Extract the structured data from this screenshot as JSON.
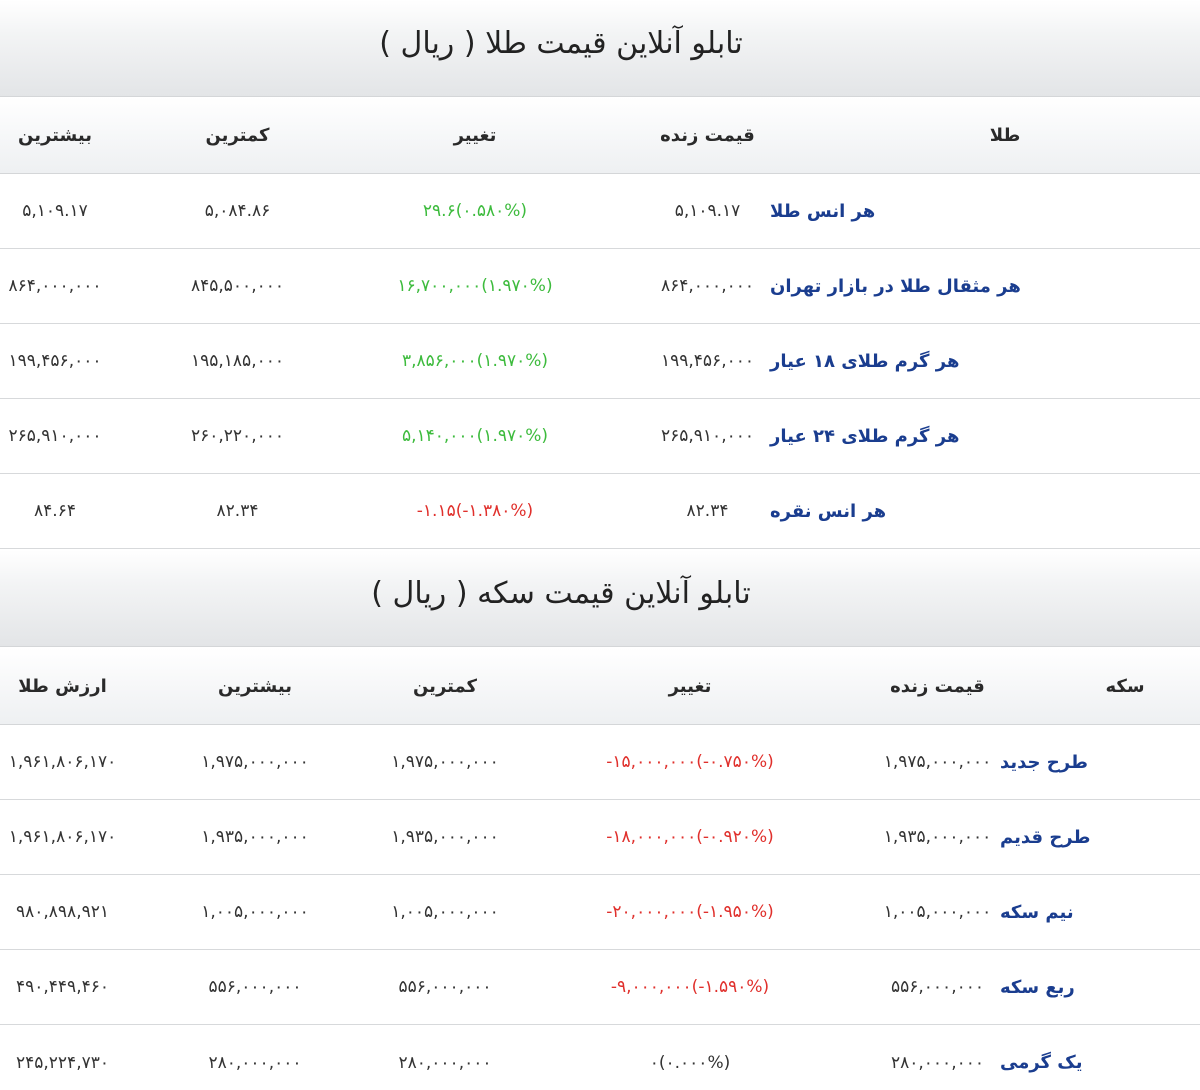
{
  "gold_board": {
    "title": "تابلو آنلاین قیمت طلا ( ریال )",
    "headers": {
      "name": "طلا",
      "live_price": "قیمت زنده",
      "change": "تغییر",
      "lowest": "کمترین",
      "highest": "بیشترین"
    },
    "rows": [
      {
        "name": "هر انس طلا",
        "live_price": "۵,۱۰۹.۱۷",
        "change": "۲۹.۶(۰.۵۸۰%)",
        "direction": "up",
        "lowest": "۵,۰۸۴.۸۶",
        "highest": "۵,۱۰۹.۱۷"
      },
      {
        "name": "هر مثقال طلا در بازار تهران",
        "live_price": "۸۶۴,۰۰۰,۰۰۰",
        "change": "۱۶,۷۰۰,۰۰۰(۱.۹۷۰%)",
        "direction": "up",
        "lowest": "۸۴۵,۵۰۰,۰۰۰",
        "highest": "۸۶۴,۰۰۰,۰۰۰"
      },
      {
        "name": "هر گرم طلای ۱۸ عیار",
        "live_price": "۱۹۹,۴۵۶,۰۰۰",
        "change": "۳,۸۵۶,۰۰۰(۱.۹۷۰%)",
        "direction": "up",
        "lowest": "۱۹۵,۱۸۵,۰۰۰",
        "highest": "۱۹۹,۴۵۶,۰۰۰"
      },
      {
        "name": "هر گرم طلای ۲۴ عیار",
        "live_price": "۲۶۵,۹۱۰,۰۰۰",
        "change": "۵,۱۴۰,۰۰۰(۱.۹۷۰%)",
        "direction": "up",
        "lowest": "۲۶۰,۲۲۰,۰۰۰",
        "highest": "۲۶۵,۹۱۰,۰۰۰"
      },
      {
        "name": "هر انس نقره",
        "live_price": "۸۲.۳۴",
        "change": "-۱.۱۵(-۱.۳۸۰%)",
        "direction": "down",
        "lowest": "۸۲.۳۴",
        "highest": "۸۴.۶۴"
      }
    ]
  },
  "coin_board": {
    "title": "تابلو آنلاین قیمت سکه ( ریال )",
    "headers": {
      "name": "سکه",
      "live_price": "قیمت زنده",
      "change": "تغییر",
      "lowest": "کمترین",
      "highest": "بیشترین",
      "gold_value": "ارزش طلا"
    },
    "rows": [
      {
        "name": "طرح جدید",
        "live_price": "۱,۹۷۵,۰۰۰,۰۰۰",
        "change": "-۱۵,۰۰۰,۰۰۰(-۰.۷۵۰%)",
        "direction": "down",
        "lowest": "۱,۹۷۵,۰۰۰,۰۰۰",
        "highest": "۱,۹۷۵,۰۰۰,۰۰۰",
        "gold_value": "۱,۹۶۱,۸۰۶,۱۷۰"
      },
      {
        "name": "طرح قدیم",
        "live_price": "۱,۹۳۵,۰۰۰,۰۰۰",
        "change": "-۱۸,۰۰۰,۰۰۰(-۰.۹۲۰%)",
        "direction": "down",
        "lowest": "۱,۹۳۵,۰۰۰,۰۰۰",
        "highest": "۱,۹۳۵,۰۰۰,۰۰۰",
        "gold_value": "۱,۹۶۱,۸۰۶,۱۷۰"
      },
      {
        "name": "نیم سکه",
        "live_price": "۱,۰۰۵,۰۰۰,۰۰۰",
        "change": "-۲۰,۰۰۰,۰۰۰(-۱.۹۵۰%)",
        "direction": "down",
        "lowest": "۱,۰۰۵,۰۰۰,۰۰۰",
        "highest": "۱,۰۰۵,۰۰۰,۰۰۰",
        "gold_value": "۹۸۰,۸۹۸,۹۲۱"
      },
      {
        "name": "ربع سکه",
        "live_price": "۵۵۶,۰۰۰,۰۰۰",
        "change": "-۹,۰۰۰,۰۰۰(-۱.۵۹۰%)",
        "direction": "down",
        "lowest": "۵۵۶,۰۰۰,۰۰۰",
        "highest": "۵۵۶,۰۰۰,۰۰۰",
        "gold_value": "۴۹۰,۴۴۹,۴۶۰"
      },
      {
        "name": "یک گرمی",
        "live_price": "۲۸۰,۰۰۰,۰۰۰",
        "change": "۰(۰.۰۰۰%)",
        "direction": "flat",
        "lowest": "۲۸۰,۰۰۰,۰۰۰",
        "highest": "۲۸۰,۰۰۰,۰۰۰",
        "gold_value": "۲۴۵,۲۲۴,۷۳۰"
      }
    ]
  }
}
